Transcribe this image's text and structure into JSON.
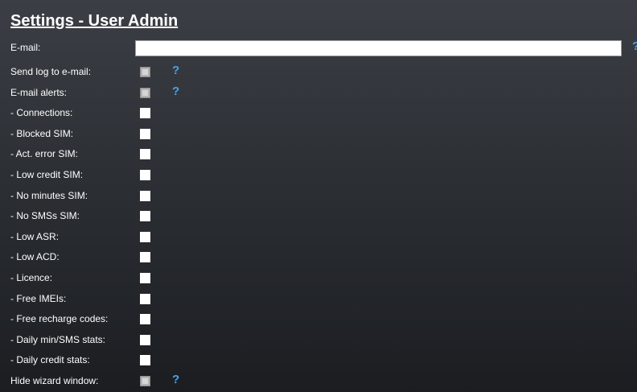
{
  "title": "Settings - User Admin",
  "email": {
    "label": "E-mail:",
    "value": "",
    "help": "?"
  },
  "rows": [
    {
      "label": "Send log to e-mail:",
      "disabled": true,
      "help": "?"
    },
    {
      "label": "E-mail alerts:",
      "disabled": true,
      "help": "?"
    },
    {
      "label": "- Connections:",
      "disabled": false
    },
    {
      "label": "- Blocked SIM:",
      "disabled": false
    },
    {
      "label": "- Act. error SIM:",
      "disabled": false
    },
    {
      "label": "- Low credit SIM:",
      "disabled": false
    },
    {
      "label": "- No minutes SIM:",
      "disabled": false
    },
    {
      "label": "- No SMSs SIM:",
      "disabled": false
    },
    {
      "label": "- Low ASR:",
      "disabled": false
    },
    {
      "label": "- Low ACD:",
      "disabled": false
    },
    {
      "label": "- Licence:",
      "disabled": false
    },
    {
      "label": "- Free IMEIs:",
      "disabled": false
    },
    {
      "label": "- Free recharge codes:",
      "disabled": false
    },
    {
      "label": "- Daily min/SMS stats:",
      "disabled": false
    },
    {
      "label": "- Daily credit stats:",
      "disabled": false
    },
    {
      "label": "Hide wizard window:",
      "disabled": true,
      "help": "?"
    }
  ],
  "colors": {
    "help_icon": "#4ea1e6",
    "panel_top": "#3b3f45",
    "panel_bottom": "#1b1d21"
  }
}
